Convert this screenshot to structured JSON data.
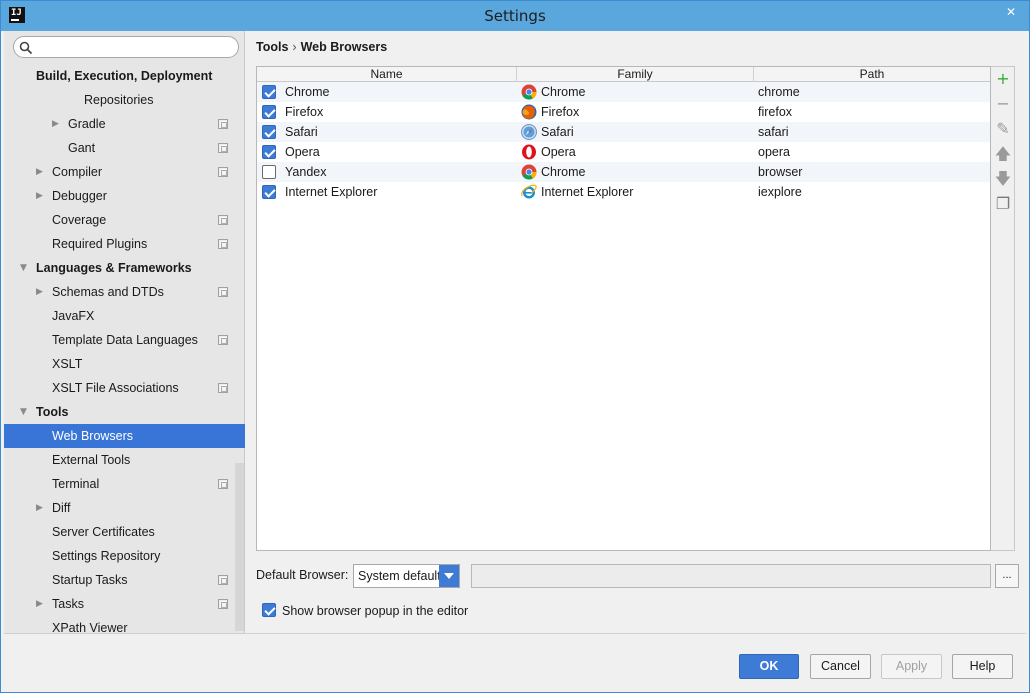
{
  "window": {
    "title": "Settings",
    "app_icon": "IJ",
    "close_glyph": "✕"
  },
  "search": {
    "placeholder": ""
  },
  "sidebar": {
    "items": [
      {
        "label": "Build, Execution, Deployment",
        "level": 0,
        "bold": true,
        "arrow": "none",
        "project": false,
        "selected": false
      },
      {
        "label": "Repositories",
        "level": 1,
        "bold": false,
        "arrow": "none",
        "project": false,
        "selected": false
      },
      {
        "label": "Gradle",
        "level": 2,
        "bold": false,
        "arrow": "right",
        "project": true,
        "selected": false
      },
      {
        "label": "Gant",
        "level": 2,
        "bold": false,
        "arrow": "none",
        "project": true,
        "selected": false
      },
      {
        "label": "Compiler",
        "level": 1,
        "bold": false,
        "arrow": "right",
        "project": true,
        "selected": false
      },
      {
        "label": "Debugger",
        "level": 1,
        "bold": false,
        "arrow": "right",
        "project": false,
        "selected": false
      },
      {
        "label": "Coverage",
        "level": 1,
        "bold": false,
        "arrow": "none",
        "project": true,
        "selected": false
      },
      {
        "label": "Required Plugins",
        "level": 1,
        "bold": false,
        "arrow": "none",
        "project": true,
        "selected": false
      },
      {
        "label": "Languages & Frameworks",
        "level": 0,
        "bold": true,
        "arrow": "down",
        "project": false,
        "selected": false
      },
      {
        "label": "Schemas and DTDs",
        "level": 1,
        "bold": false,
        "arrow": "right",
        "project": true,
        "selected": false
      },
      {
        "label": "JavaFX",
        "level": 1,
        "bold": false,
        "arrow": "none",
        "project": false,
        "selected": false
      },
      {
        "label": "Template Data Languages",
        "level": 1,
        "bold": false,
        "arrow": "none",
        "project": true,
        "selected": false
      },
      {
        "label": "XSLT",
        "level": 1,
        "bold": false,
        "arrow": "none",
        "project": false,
        "selected": false
      },
      {
        "label": "XSLT File Associations",
        "level": 1,
        "bold": false,
        "arrow": "none",
        "project": true,
        "selected": false
      },
      {
        "label": "Tools",
        "level": 0,
        "bold": true,
        "arrow": "down",
        "project": false,
        "selected": false
      },
      {
        "label": "Web Browsers",
        "level": 1,
        "bold": false,
        "arrow": "none",
        "project": false,
        "selected": true
      },
      {
        "label": "External Tools",
        "level": 1,
        "bold": false,
        "arrow": "none",
        "project": false,
        "selected": false
      },
      {
        "label": "Terminal",
        "level": 1,
        "bold": false,
        "arrow": "none",
        "project": true,
        "selected": false
      },
      {
        "label": "Diff",
        "level": 1,
        "bold": false,
        "arrow": "right",
        "project": false,
        "selected": false
      },
      {
        "label": "Server Certificates",
        "level": 1,
        "bold": false,
        "arrow": "none",
        "project": false,
        "selected": false
      },
      {
        "label": "Settings Repository",
        "level": 1,
        "bold": false,
        "arrow": "none",
        "project": false,
        "selected": false
      },
      {
        "label": "Startup Tasks",
        "level": 1,
        "bold": false,
        "arrow": "none",
        "project": true,
        "selected": false
      },
      {
        "label": "Tasks",
        "level": 1,
        "bold": false,
        "arrow": "right",
        "project": true,
        "selected": false
      },
      {
        "label": "XPath Viewer",
        "level": 1,
        "bold": false,
        "arrow": "none",
        "project": false,
        "selected": false
      }
    ]
  },
  "breadcrumb": {
    "parent": "Tools",
    "separator": "›",
    "current": "Web Browsers"
  },
  "table": {
    "columns": [
      "Name",
      "Family",
      "Path"
    ],
    "rows": [
      {
        "checked": true,
        "name": "Chrome",
        "family": "Chrome",
        "family_icon": "chrome-icon",
        "path": "chrome"
      },
      {
        "checked": true,
        "name": "Firefox",
        "family": "Firefox",
        "family_icon": "firefox-icon",
        "path": "firefox"
      },
      {
        "checked": true,
        "name": "Safari",
        "family": "Safari",
        "family_icon": "safari-icon",
        "path": "safari"
      },
      {
        "checked": true,
        "name": "Opera",
        "family": "Opera",
        "family_icon": "opera-icon",
        "path": "opera"
      },
      {
        "checked": false,
        "name": "Yandex",
        "family": "Chrome",
        "family_icon": "chrome-icon",
        "path": "browser"
      },
      {
        "checked": true,
        "name": "Internet Explorer",
        "family": "Internet Explorer",
        "family_icon": "ie-icon",
        "path": "iexplore"
      }
    ]
  },
  "toolbar": {
    "buttons": [
      {
        "name": "add-icon",
        "glyph": "+",
        "color": "#3aa83a"
      },
      {
        "name": "remove-icon",
        "glyph": "−",
        "color": "#9a9a9a"
      },
      {
        "name": "edit-icon",
        "glyph": "✎",
        "color": "#9a9a9a"
      },
      {
        "name": "move-up-icon",
        "glyph": "🡅",
        "color": "#9a9a9a"
      },
      {
        "name": "move-down-icon",
        "glyph": "🡇",
        "color": "#9a9a9a"
      },
      {
        "name": "copy-icon",
        "glyph": "❐",
        "color": "#7a7a7a"
      }
    ]
  },
  "default_browser": {
    "label": "Default Browser:",
    "value": "System default",
    "path_value": "",
    "browse_label": "..."
  },
  "popup_option": {
    "label": "Show browser popup in the editor",
    "checked": true
  },
  "buttons": {
    "ok": "OK",
    "cancel": "Cancel",
    "apply": "Apply",
    "help": "Help"
  },
  "colors": {
    "accent": "#3d7bd6",
    "title_bar": "#5aa7de",
    "selection": "#3875d7"
  }
}
